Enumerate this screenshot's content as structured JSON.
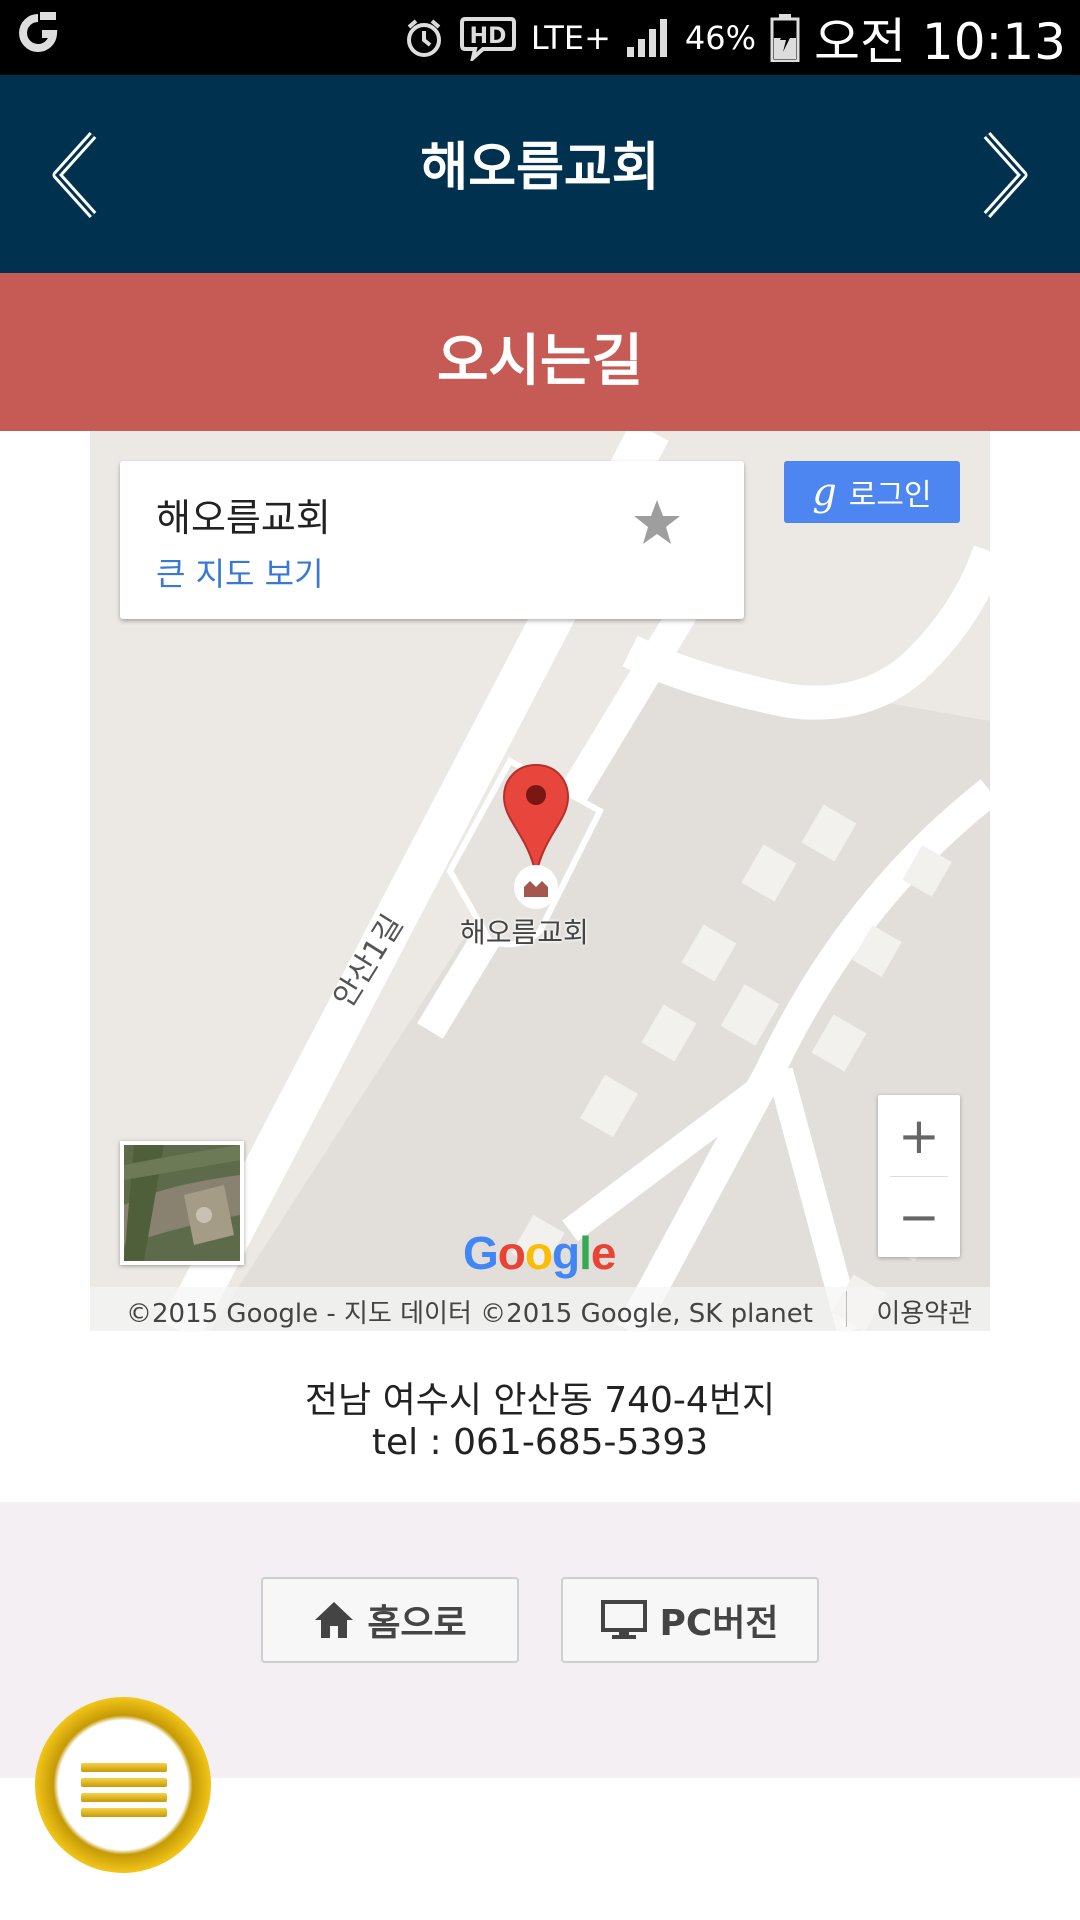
{
  "status_bar": {
    "time": "오전 10:13",
    "battery": "46%",
    "network": "LTE+",
    "hd": "HD"
  },
  "header": {
    "title": "해오름교회",
    "prev_icon": "chevron-left-icon",
    "next_icon": "chevron-right-icon"
  },
  "section": {
    "title": "오시는길"
  },
  "map": {
    "place_card": {
      "name": "해오름교회",
      "link": "큰 지도 보기",
      "star_icon": "star-icon"
    },
    "login_button": {
      "g": "g",
      "label": "로그인"
    },
    "marker_label": "해오름교회",
    "street_label": "안산1길",
    "zoom_in": "+",
    "zoom_out": "−",
    "google_logo": "Google",
    "attribution": "©2015 Google - 지도 데이터 ©2015 Google, SK planet",
    "terms": "이용약관"
  },
  "address": {
    "line1": "전남 여수시 안산동 740-4번지",
    "line2": "tel : 061-685-5393"
  },
  "footer": {
    "home_label": "홈으로",
    "pc_label": "PC버전"
  },
  "colors": {
    "header_bg": "#00324f",
    "section_bg": "#c65a54",
    "footer_bg": "#f4eff2",
    "login_blue": "#4d86f0",
    "link_blue": "#3a78d8"
  }
}
